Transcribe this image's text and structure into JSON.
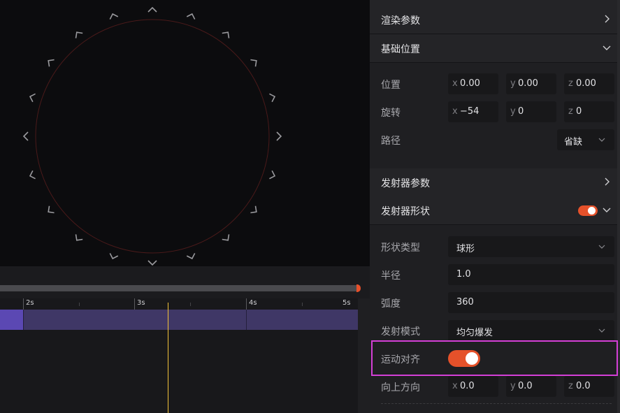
{
  "timeline": {
    "labels": [
      "2s",
      "3s",
      "4s",
      "5s"
    ]
  },
  "panel": {
    "sections": {
      "render_params": "渲染参数",
      "base_position": "基础位置",
      "emitter_params": "发射器参数",
      "emitter_shape": "发射器形状"
    },
    "position": {
      "label": "位置",
      "x_axis": "x",
      "x": "0.00",
      "y_axis": "y",
      "y": "0.00",
      "z_axis": "z",
      "z": "0.00"
    },
    "rotation": {
      "label": "旋转",
      "x_axis": "x",
      "x": "−54",
      "y_axis": "y",
      "y": "0",
      "z_axis": "z",
      "z": "0"
    },
    "path": {
      "label": "路径",
      "value": "省缺"
    },
    "shape_type": {
      "label": "形状类型",
      "value": "球形"
    },
    "radius": {
      "label": "半径",
      "value": "1.0"
    },
    "arc": {
      "label": "弧度",
      "value": "360"
    },
    "emit_mode": {
      "label": "发射模式",
      "value": "均匀爆发"
    },
    "motion_align": {
      "label": "运动对齐",
      "enabled": true
    },
    "up_direction": {
      "label": "向上方向",
      "x_axis": "x",
      "x": "0.0",
      "y_axis": "y",
      "y": "0.0",
      "z_axis": "z",
      "z": "0.0"
    },
    "emitter_shape_enabled": true
  },
  "colors": {
    "accent": "#e5512a",
    "track": "#3f3766",
    "track_active": "#5b48b3",
    "playhead": "#f3c23a",
    "highlight": "#d43fd6",
    "sphere_outline": "#4a1a1a"
  },
  "icons": [
    "chevron-right-icon",
    "chevron-down-icon",
    "bracket-marker-icon"
  ]
}
